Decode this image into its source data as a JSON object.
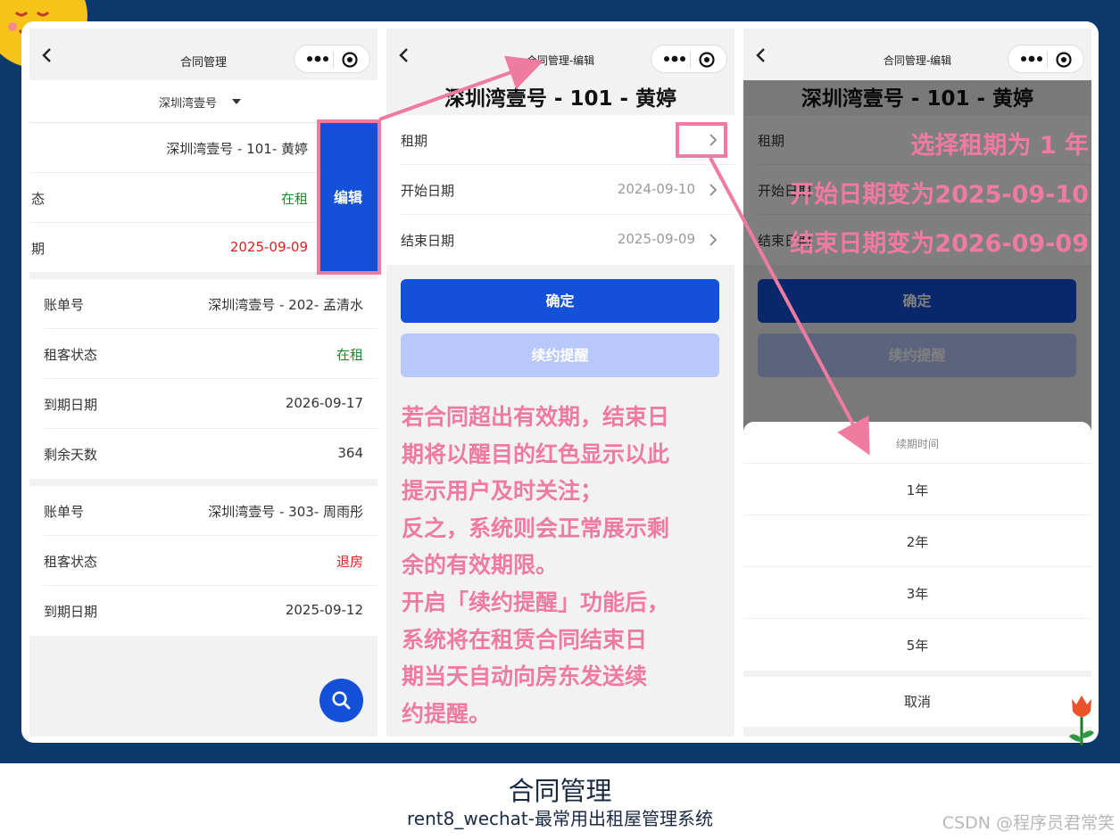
{
  "panel1": {
    "nav_title": "合同管理",
    "property_filter": "深圳湾壹号",
    "swiped_card": {
      "account": "深圳湾壹号 - 101- 黄婷",
      "status_label_partial": "态",
      "status": "在租",
      "due_label_partial": "期",
      "due_date": "2025-09-09",
      "edit_label": "编辑"
    },
    "cards": [
      {
        "rows": [
          {
            "label": "账单号",
            "value": "深圳湾壹号 - 202- 孟清水",
            "tone": "normal"
          },
          {
            "label": "租客状态",
            "value": "在租",
            "tone": "green"
          },
          {
            "label": "到期日期",
            "value": "2026-09-17",
            "tone": "normal"
          },
          {
            "label": "剩余天数",
            "value": "364",
            "tone": "normal"
          }
        ]
      },
      {
        "rows": [
          {
            "label": "账单号",
            "value": "深圳湾壹号 - 303- 周雨彤",
            "tone": "normal"
          },
          {
            "label": "租客状态",
            "value": "退房",
            "tone": "red"
          },
          {
            "label": "到期日期",
            "value": "2025-09-12",
            "tone": "normal"
          }
        ]
      }
    ]
  },
  "panel2": {
    "nav_title": "合同管理-编辑",
    "heading": "深圳湾壹号 - 101 - 黄婷",
    "fields": [
      {
        "label": "租期",
        "value": ""
      },
      {
        "label": "开始日期",
        "value": "2024-09-10"
      },
      {
        "label": "结束日期",
        "value": "2025-09-09"
      }
    ],
    "confirm_label": "确定",
    "renew_label": "续约提醒",
    "annotation_lines": [
      "若合同超出有效期，结束日",
      "期将以醒目的红色显示以此",
      "提示用户及时关注；",
      "反之，系统则会正常展示剩",
      "余的有效期限。",
      "开启「续约提醒」功能后，",
      "系统将在租赁合同结束日",
      "期当天自动向房东发送续",
      "约提醒。"
    ]
  },
  "panel3": {
    "nav_title": "合同管理-编辑",
    "heading": "深圳湾壹号 - 101 - 黄婷",
    "field_labels": [
      "租期",
      "开始日期",
      "结束日期"
    ],
    "confirm_label": "确定",
    "renew_label": "续约提醒",
    "sheet_title": "续期时间",
    "options": [
      "1年",
      "2年",
      "3年",
      "5年"
    ],
    "cancel_label": "取消",
    "annotation_lines": [
      "选择租期为 1 年",
      "开始日期变为2025-09-10",
      "结束日期变为2026-09-09"
    ]
  },
  "caption": {
    "title": "合同管理",
    "subtitle": "rent8_wechat-最常用出租屋管理系统",
    "watermark": "CSDN @程序员君常笑"
  },
  "colors": {
    "background": "#0c3a6a",
    "primary": "#1351d8",
    "annotation": "#f07ba0",
    "in_rent": "#1b8a2b",
    "overdue": "#e02020"
  },
  "icons": [
    "back-arrow-icon",
    "more-dots-icon",
    "record-ring-icon",
    "caret-down-icon",
    "chevron-right-icon",
    "search-icon",
    "sun-icon",
    "tulip-icon"
  ]
}
